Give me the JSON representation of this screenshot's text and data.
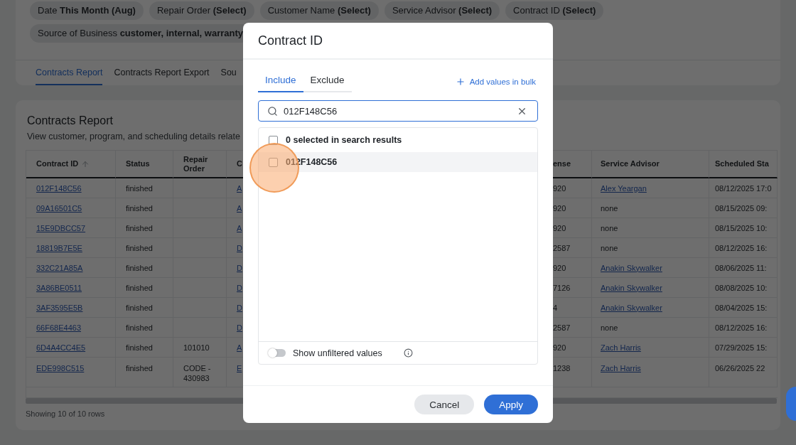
{
  "filters": [
    {
      "text": "Date **This Month (Aug)**"
    },
    {
      "text": "Repair Order **(Select)**"
    },
    {
      "text": "Customer Name **(Select)**"
    },
    {
      "text": "Service Advisor **(Select)**"
    },
    {
      "text": "Contract ID **(Select)**"
    },
    {
      "text": "Source of Business **customer, internal, warranty**"
    }
  ],
  "report_tabs": [
    {
      "label": "Contracts Report",
      "selected": true
    },
    {
      "label": "Contracts Report Export",
      "selected": false
    },
    {
      "label": "Sou",
      "selected": false
    }
  ],
  "report": {
    "title": "Contracts Report",
    "description": "View customer, program, and scheduling details relate",
    "columns": [
      {
        "label": "Contract ID",
        "sorted_ascending": true
      },
      {
        "label": "Status"
      },
      {
        "label": "Repair Order"
      },
      {
        "label": "C"
      },
      {
        "label": "ense"
      },
      {
        "label": "Service Advisor"
      },
      {
        "label": "Scheduled Sta"
      }
    ],
    "rows": [
      [
        {
          "kind": "link",
          "text": "012F148C56"
        },
        {
          "kind": "text",
          "text": "finished"
        },
        {
          "kind": "empty"
        },
        {
          "kind": "link",
          "text": "A"
        },
        {
          "kind": "text",
          "text": "920"
        },
        {
          "kind": "link",
          "text": "Alex Yeargan"
        },
        {
          "kind": "text",
          "text": "08/12/2025 17:0"
        }
      ],
      [
        {
          "kind": "link",
          "text": "09A16501C5"
        },
        {
          "kind": "text",
          "text": "finished"
        },
        {
          "kind": "empty"
        },
        {
          "kind": "link",
          "text": "A"
        },
        {
          "kind": "text",
          "text": "920"
        },
        {
          "kind": "text",
          "text": "none"
        },
        {
          "kind": "text",
          "text": "08/15/2025 09:"
        }
      ],
      [
        {
          "kind": "link",
          "text": "15E9DBCC57"
        },
        {
          "kind": "text",
          "text": "finished"
        },
        {
          "kind": "empty"
        },
        {
          "kind": "link",
          "text": "A"
        },
        {
          "kind": "text",
          "text": "920"
        },
        {
          "kind": "text",
          "text": "none"
        },
        {
          "kind": "text",
          "text": "08/15/2025 10:"
        }
      ],
      [
        {
          "kind": "link",
          "text": "18819B7E5E"
        },
        {
          "kind": "text",
          "text": "finished"
        },
        {
          "kind": "empty"
        },
        {
          "kind": "link",
          "text": "D"
        },
        {
          "kind": "text",
          "text": "2587"
        },
        {
          "kind": "text",
          "text": "none"
        },
        {
          "kind": "text",
          "text": "08/12/2025 16:"
        }
      ],
      [
        {
          "kind": "link",
          "text": "332C21A85A"
        },
        {
          "kind": "text",
          "text": "finished"
        },
        {
          "kind": "empty"
        },
        {
          "kind": "link",
          "text": "D"
        },
        {
          "kind": "text",
          "text": "920"
        },
        {
          "kind": "link",
          "text": "Anakin Skywalker"
        },
        {
          "kind": "text",
          "text": "08/06/2025 11:"
        }
      ],
      [
        {
          "kind": "link",
          "text": "3A86BE0511"
        },
        {
          "kind": "text",
          "text": "finished"
        },
        {
          "kind": "empty"
        },
        {
          "kind": "link",
          "text": "D"
        },
        {
          "kind": "text",
          "text": "7126"
        },
        {
          "kind": "link",
          "text": "Anakin Skywalker"
        },
        {
          "kind": "text",
          "text": "08/08/2025 10:"
        }
      ],
      [
        {
          "kind": "link",
          "text": "3AF3595E5B"
        },
        {
          "kind": "text",
          "text": "finished"
        },
        {
          "kind": "empty"
        },
        {
          "kind": "link",
          "text": "D"
        },
        {
          "kind": "text",
          "text": "4"
        },
        {
          "kind": "link",
          "text": "Anakin Skywalker"
        },
        {
          "kind": "text",
          "text": "08/04/2025 15:"
        }
      ],
      [
        {
          "kind": "link",
          "text": "66F68E4463"
        },
        {
          "kind": "text",
          "text": "finished"
        },
        {
          "kind": "empty"
        },
        {
          "kind": "link",
          "text": "D"
        },
        {
          "kind": "text",
          "text": "2587"
        },
        {
          "kind": "text",
          "text": "none"
        },
        {
          "kind": "text",
          "text": "08/12/2025 16:"
        }
      ],
      [
        {
          "kind": "link",
          "text": "6D4A4CC4E5"
        },
        {
          "kind": "text",
          "text": "finished"
        },
        {
          "kind": "text",
          "text": "101010"
        },
        {
          "kind": "link",
          "text": "A"
        },
        {
          "kind": "text",
          "text": "920"
        },
        {
          "kind": "link",
          "text": "Zach Harris"
        },
        {
          "kind": "text",
          "text": "07/29/2025 15:"
        }
      ],
      [
        {
          "kind": "link",
          "text": "EDE998C515"
        },
        {
          "kind": "text",
          "text": "finished"
        },
        {
          "kind": "text",
          "text": "CODE - 430983"
        },
        {
          "kind": "link",
          "text": "E"
        },
        {
          "kind": "text",
          "text": "1238"
        },
        {
          "kind": "link",
          "text": "Zach Harris"
        },
        {
          "kind": "text",
          "text": "06/26/2025 22"
        }
      ]
    ],
    "footer": "Showing 10 of 10 rows"
  },
  "dialog": {
    "title": "Contract ID",
    "tabs": [
      {
        "label": "Include",
        "selected": true
      },
      {
        "label": "Exclude",
        "selected": false
      }
    ],
    "bulk_link": "Add values in bulk",
    "search": {
      "value": "012F148C56"
    },
    "select_all": {
      "label": "0 selected in search results",
      "checked": false
    },
    "options": [
      {
        "label": "012F148C56",
        "checked": false,
        "hovered": true
      }
    ],
    "unfiltered_toggle": {
      "label": "Show unfiltered values",
      "on": false
    },
    "buttons": [
      {
        "label": "Cancel",
        "kind": "secondary"
      },
      {
        "label": "Apply",
        "kind": "primary"
      }
    ]
  }
}
